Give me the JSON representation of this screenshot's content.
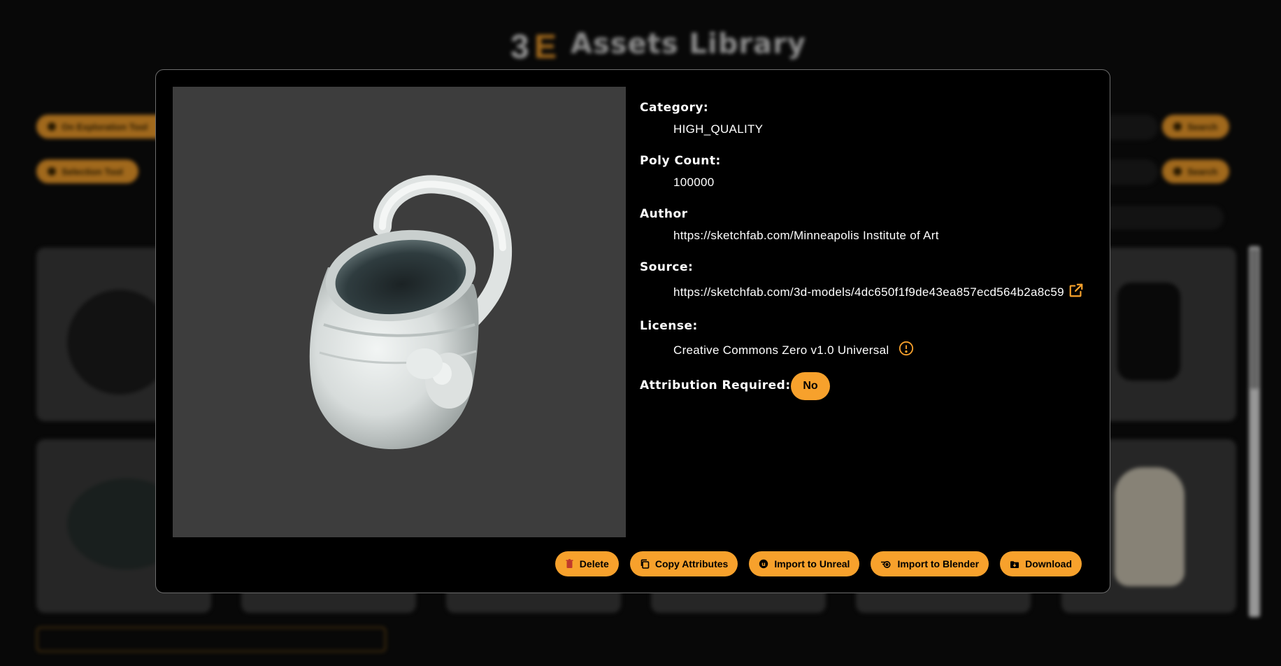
{
  "app": {
    "title": "Assets Library",
    "background_buttons": [
      "On Exploration Tool",
      "Selection Tool",
      "Search",
      "Search"
    ]
  },
  "asset": {
    "category_label": "Category:",
    "category": "HIGH_QUALITY",
    "poly_count_label": "Poly Count:",
    "poly_count": "100000",
    "author_label": "Author",
    "author": "https://sketchfab.com/Minneapolis Institute of Art",
    "source_label": "Source:",
    "source": "https://sketchfab.com/3d-models/4dc650f1f9de43ea857ecd564b2a8c59",
    "license_label": "License:",
    "license": "Creative Commons Zero v1.0 Universal",
    "attribution_label": "Attribution Required:",
    "attribution": "No"
  },
  "actions": {
    "delete": "Delete",
    "copy_attributes": "Copy Attributes",
    "import_unreal": "Import to Unreal",
    "import_blender": "Import to Blender",
    "download": "Download"
  },
  "colors": {
    "accent": "#f7a12c",
    "modal_bg": "#000000",
    "preview_bg": "#3d3d3d",
    "page_bg": "#0d0d0d"
  },
  "icons": {
    "external_link": "external-link-icon",
    "license_info": "info-circle-icon",
    "delete": "trash-icon",
    "copy": "copy-icon",
    "unreal": "unreal-icon",
    "blender": "blender-icon",
    "download": "download-icon"
  }
}
